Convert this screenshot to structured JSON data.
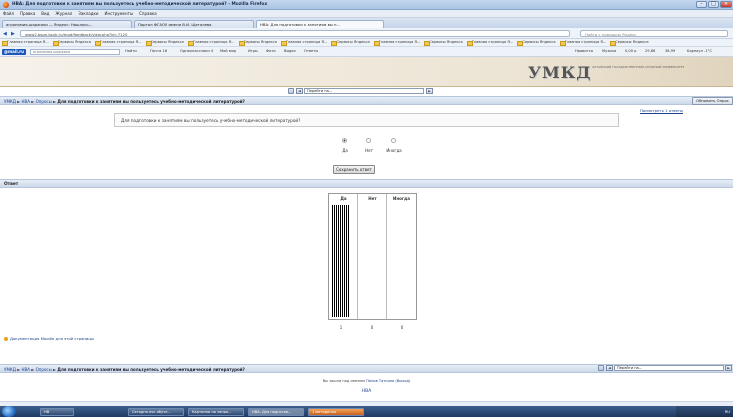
{
  "window": {
    "title": "НВА: Для подготовки к занятиям вы пользуетесь учебно-методической литературой? - Mozilla Firefox"
  },
  "menu": [
    "Файл",
    "Правка",
    "Вид",
    "Журнал",
    "Закладки",
    "Инструменты",
    "Справка"
  ],
  "tabs": [
    {
      "label": "агрономия-шаржики — Яндекс: Нашлось..."
    },
    {
      "label": "Портал ФГАОУ имени В.И. Щеголева"
    },
    {
      "label": "НВА: Для подготовки к занятиям вы п..."
    }
  ],
  "nav": {
    "url": "www2.bsgn.bsuk.ru/mod/feedback/view.php?id=7120",
    "search_placeholder": "Найти с помощью Яндекс"
  },
  "bookmarks": [
    "Главная страница Я...",
    "Сервисы Яндекса",
    "Главная страница Я...",
    "Сервисы Яндекса",
    "Главная страница Я...",
    "Сервисы Яндекса",
    "Главная страница Я...",
    "Сервисы Яндекса",
    "Главная страница Я...",
    "Сервисы Яндекса",
    "Главная страница Я...",
    "Сервисы Яндекса",
    "Главная страница Я...",
    "Сервисы Яндекса"
  ],
  "mailbar": {
    "logo": "@mail.ru",
    "search": "агрономия-шаржики",
    "items": [
      "Найти",
      "Почта 16",
      "Одноклассники 4",
      "Мой мир",
      "Игры",
      "Фото",
      "Видео",
      "Ответы",
      "Нравится",
      "Музыка",
      "0,00 р",
      "29,66",
      "38,99",
      "Барнаул -1°C"
    ]
  },
  "banner": {
    "logo_word": "УМКД",
    "logo_sub": "АЛТАЙСКИЙ ГОСУДАРСТВЕННЫЙ АГРАРНЫЙ УНИВЕРСИТЕТ"
  },
  "jump": {
    "label": "Перейти на..."
  },
  "breadcrumb": {
    "items": [
      "УМКД",
      "НВА",
      "Опросы"
    ],
    "sep": "►",
    "current": "Для подготовки к занятиям вы пользуетесь учебно-методической литературой?"
  },
  "buttons": {
    "update": "Обновить Опрос",
    "save": "Сохранить ответ"
  },
  "view_responses": "Посмотреть 1 ответы",
  "question": "Для подготовки к занятиям вы пользуетесь учебно-методической литературой?",
  "options": [
    {
      "label": "Да",
      "checked": true
    },
    {
      "label": "Нет",
      "checked": false
    },
    {
      "label": "Иногда",
      "checked": false
    }
  ],
  "answer_heading": "Ответ",
  "chart_data": {
    "type": "bar",
    "categories": [
      "Да",
      "Нет",
      "Иногда"
    ],
    "values": [
      1,
      0,
      0
    ],
    "ylim": [
      0,
      1
    ]
  },
  "moodle_doc": "Документация Moodle для этой страницы",
  "footer": {
    "logged_prefix": "Вы зашли под именем",
    "user": "Попов Татьяна",
    "logout": "(Выход)",
    "home": "НВА"
  },
  "taskbar": {
    "items": [
      "НВ",
      "Сегодня очк обуче...",
      "Картинки по запро...",
      "НВА: Для подготов...",
      "1 методичка"
    ],
    "tray": "RU"
  }
}
